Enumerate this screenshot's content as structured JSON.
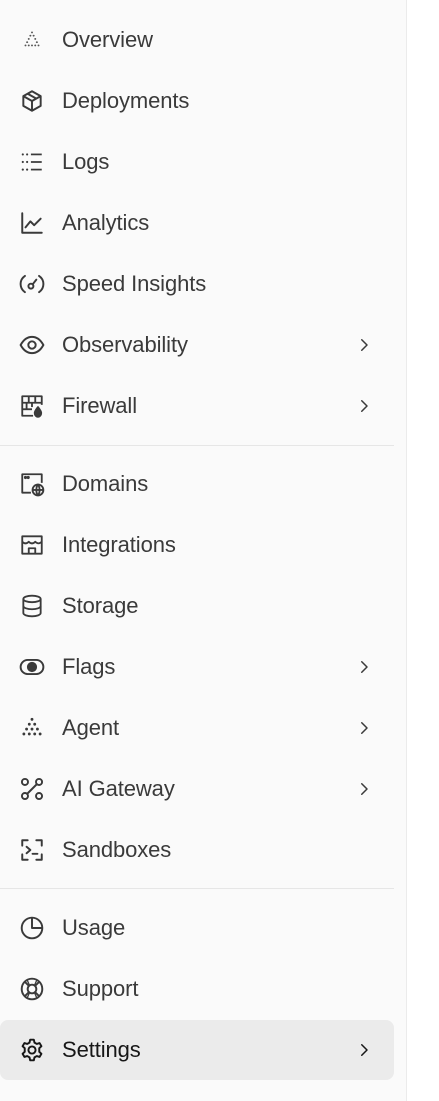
{
  "sections": [
    {
      "items": [
        {
          "label": "Overview",
          "icon": "triangle-dots-icon",
          "chevron": false
        },
        {
          "label": "Deployments",
          "icon": "cube-icon",
          "chevron": false
        },
        {
          "label": "Logs",
          "icon": "list-dots-icon",
          "chevron": false
        },
        {
          "label": "Analytics",
          "icon": "line-chart-icon",
          "chevron": false
        },
        {
          "label": "Speed Insights",
          "icon": "gauge-icon",
          "chevron": false
        },
        {
          "label": "Observability",
          "icon": "eye-icon",
          "chevron": true
        },
        {
          "label": "Firewall",
          "icon": "firewall-icon",
          "chevron": true
        }
      ]
    },
    {
      "items": [
        {
          "label": "Domains",
          "icon": "globe-window-icon",
          "chevron": false
        },
        {
          "label": "Integrations",
          "icon": "storefront-icon",
          "chevron": false
        },
        {
          "label": "Storage",
          "icon": "database-icon",
          "chevron": false
        },
        {
          "label": "Flags",
          "icon": "toggle-icon",
          "chevron": true
        },
        {
          "label": "Agent",
          "icon": "dots-pyramid-icon",
          "chevron": true
        },
        {
          "label": "AI Gateway",
          "icon": "nodes-icon",
          "chevron": true
        },
        {
          "label": "Sandboxes",
          "icon": "terminal-bracket-icon",
          "chevron": false
        }
      ]
    },
    {
      "items": [
        {
          "label": "Usage",
          "icon": "pie-chart-icon",
          "chevron": false
        },
        {
          "label": "Support",
          "icon": "lifebuoy-icon",
          "chevron": false
        },
        {
          "label": "Settings",
          "icon": "gear-icon",
          "chevron": true,
          "active": true
        }
      ]
    }
  ],
  "colors": {
    "sidebar_bg": "#fafafa",
    "active_bg": "#ebebeb",
    "text": "#3a3a3a",
    "icon": "#3a3a3a"
  }
}
